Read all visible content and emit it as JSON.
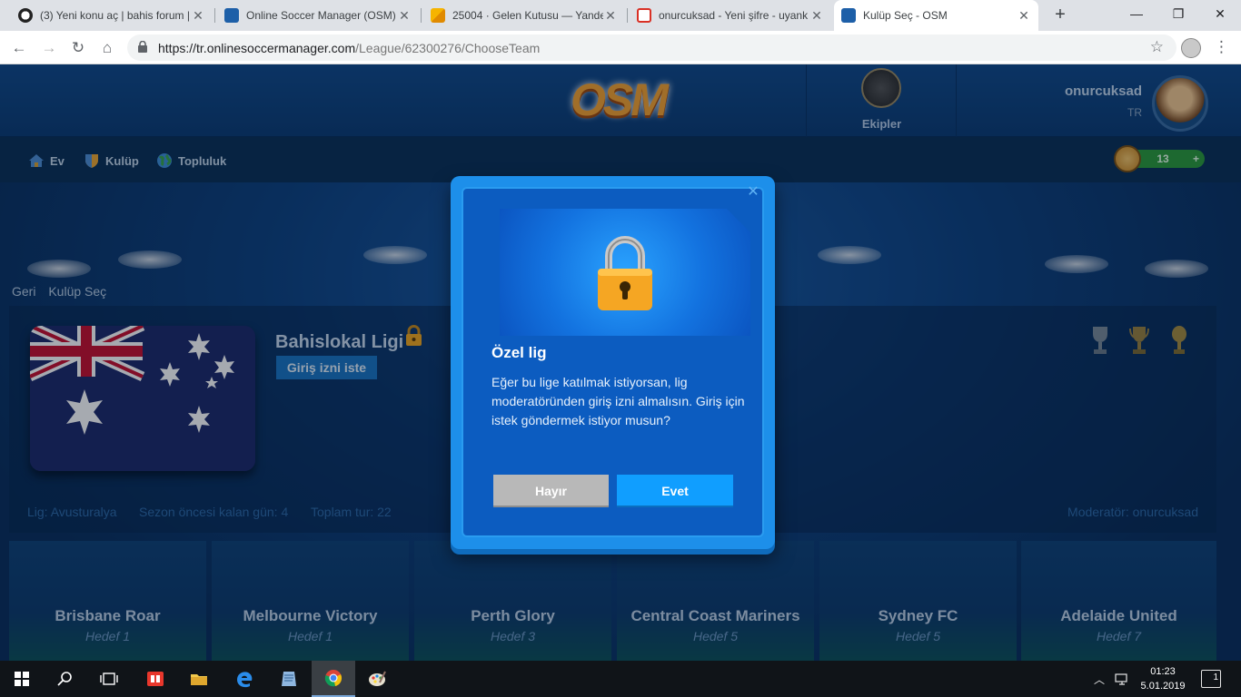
{
  "browser": {
    "tabs": [
      {
        "title": "(3) Yeni konu aç | bahis forum |",
        "active": false
      },
      {
        "title": "Online Soccer Manager (OSM)",
        "active": false
      },
      {
        "title": "25004 · Gelen Kutusu — Yande",
        "active": false
      },
      {
        "title": "onurcuksad - Yeni şifre - uyank",
        "active": false
      },
      {
        "title": "Kulüp Seç - OSM",
        "active": true
      }
    ],
    "new_tab": "+",
    "url_host": "https://tr.onlinesoccermanager.com",
    "url_path": "/League/62300276/ChooseTeam"
  },
  "header": {
    "logo": "OSM",
    "ekipler": "Ekipler",
    "username": "onurcuksad",
    "country": "TR"
  },
  "nav": {
    "items": [
      "Ev",
      "Kulüp",
      "Topluluk"
    ],
    "coins": "13",
    "coins_plus": "+"
  },
  "breadcrumb": {
    "back": "Geri",
    "current": "Kulüp Seç"
  },
  "league": {
    "name": "Bahislokal Ligi",
    "request_button": "Giriş izni iste",
    "country_label": "Lig: Avusturalya",
    "days_left": "Sezon öncesi kalan gün: 4",
    "total_rounds": "Toplam tur: 22",
    "moderator": "Moderatör: onurcuksad"
  },
  "teams": [
    {
      "name": "Brisbane Roar",
      "goal": "Hedef 1"
    },
    {
      "name": "Melbourne Victory",
      "goal": "Hedef 1"
    },
    {
      "name": "Perth Glory",
      "goal": "Hedef 3"
    },
    {
      "name": "Central Coast Mariners",
      "goal": "Hedef 5"
    },
    {
      "name": "Sydney FC",
      "goal": "Hedef 5"
    },
    {
      "name": "Adelaide United",
      "goal": "Hedef 7"
    }
  ],
  "modal": {
    "title": "Özel lig",
    "body": "Eğer bu lige katılmak istiyorsan, lig moderatöründen giriş izni almalısın. Giriş için istek göndermek istiyor musun?",
    "no_button": "Hayır",
    "yes_button": "Evet"
  },
  "taskbar": {
    "time": "01:23",
    "date": "5.01.2019",
    "notifications": "1"
  },
  "colors": {
    "accent_blue": "#109eff",
    "osm_orange": "#f6a431",
    "coin_green": "#2d9b3b"
  }
}
